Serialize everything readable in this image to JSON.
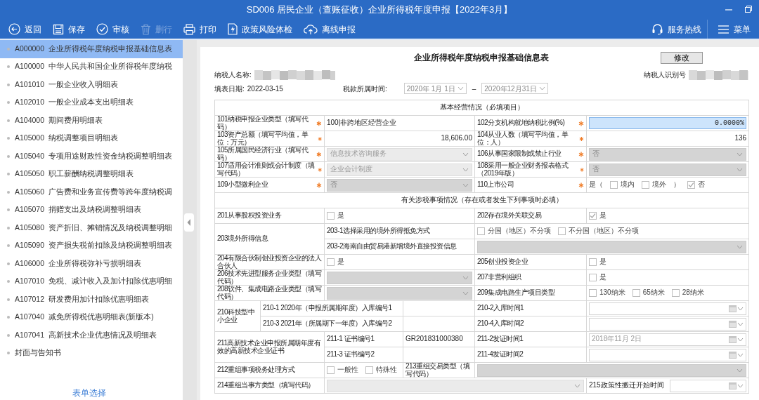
{
  "window": {
    "title": "SD006 居民企业（查账征收）企业所得税年度申报【2022年3月】"
  },
  "toolbar": [
    {
      "label": "返回",
      "disabled": false
    },
    {
      "label": "保存",
      "disabled": false
    },
    {
      "label": "审核",
      "disabled": false
    },
    {
      "label": "删行",
      "disabled": true
    },
    {
      "label": "打印",
      "disabled": false
    },
    {
      "label": "政策风险体检",
      "disabled": false
    },
    {
      "label": "离线申报",
      "disabled": false
    }
  ],
  "toolbar_right": [
    {
      "label": "服务热线"
    },
    {
      "label": "菜单"
    }
  ],
  "sidebar": {
    "items": [
      {
        "code": "A000000",
        "name": "企业所得税年度纳税申报基础信息表",
        "selected": true
      },
      {
        "code": "A100000",
        "name": "中华人民共和国企业所得税年度纳税",
        "selected": false
      },
      {
        "code": "A101010",
        "name": "一般企业收入明细表",
        "selected": false
      },
      {
        "code": "A102010",
        "name": "一般企业成本支出明细表",
        "selected": false
      },
      {
        "code": "A104000",
        "name": "期间费用明细表",
        "selected": false
      },
      {
        "code": "A105000",
        "name": "纳税调整项目明细表",
        "selected": false
      },
      {
        "code": "A105040",
        "name": "专项用途财政性资金纳税调整明细表",
        "selected": false
      },
      {
        "code": "A105050",
        "name": "职工薪酬纳税调整明细表",
        "selected": false
      },
      {
        "code": "A105060",
        "name": "广告费和业务宣传费等跨年度纳税调",
        "selected": false
      },
      {
        "code": "A105070",
        "name": "捐赠支出及纳税调整明细表",
        "selected": false
      },
      {
        "code": "A105080",
        "name": "资产折旧、摊销情况及纳税调整明细",
        "selected": false
      },
      {
        "code": "A105090",
        "name": "资产损失税前扣除及纳税调整明细表",
        "selected": false
      },
      {
        "code": "A106000",
        "name": "企业所得税弥补亏损明细表",
        "selected": false
      },
      {
        "code": "A107010",
        "name": "免税、减计收入及加计扣除优惠明细",
        "selected": false
      },
      {
        "code": "A107012",
        "name": "研发费用加计扣除优惠明细表",
        "selected": false
      },
      {
        "code": "A107040",
        "name": "减免所得税优惠明细表(新版本)",
        "selected": false
      },
      {
        "code": "A107041",
        "name": "高新技术企业优惠情况及明细表",
        "selected": false
      },
      {
        "name": "封面与告知书",
        "selected": false
      }
    ],
    "link": "表单选择"
  },
  "form": {
    "title": "企业所得税年度纳税申报基础信息表",
    "edit_button": "修改",
    "taxpayer_name_label": "纳税人名称:",
    "taxpayer_id_label": "纳税人识别号",
    "fill_date_label": "填表日期:",
    "fill_date": "2022-03-15",
    "period_label": "税款所属时间:",
    "period_from": "2020年 1月 1日",
    "period_separator": "–",
    "period_to": "2020年12月31日",
    "rows": [
      {
        "kind": "heading",
        "text": "基本经营情况（必填项目）"
      },
      {
        "kind": "pair",
        "left": {
          "label": "101纳税申报企业类型（填写代码）",
          "required": true,
          "field": {
            "kind": "text",
            "value": "100|非跨地区经营企业"
          }
        },
        "right": {
          "label": "102分支机构就地纳税比例(%)",
          "required": true,
          "field": {
            "kind": "input",
            "value": "0.0000%"
          }
        }
      },
      {
        "kind": "pair",
        "left": {
          "label": "103资产总额（填写平均值，单位：万元）",
          "required": true,
          "field": {
            "kind": "number",
            "value": "18,606.00"
          }
        },
        "right": {
          "label": "104从业人数（填写平均值，单位：人）",
          "required": true,
          "field": {
            "kind": "number",
            "value": "136"
          }
        }
      },
      {
        "kind": "pair",
        "left": {
          "label": "105所属国民经济行业（填写代码）",
          "required": true,
          "field": {
            "kind": "select",
            "locked": false,
            "value": "信息技术咨询服务"
          }
        },
        "right": {
          "label": "106从事国家限制或禁止行业",
          "required": true,
          "field": {
            "kind": "select",
            "locked": true,
            "value": "否"
          }
        }
      },
      {
        "kind": "pair",
        "left": {
          "label": "107适用会计准则或会计制度（填写代码）",
          "required": true,
          "field": {
            "kind": "select",
            "locked": false,
            "value": "企业会计制度"
          }
        },
        "right": {
          "label": "108采用一般企业财务报表格式（2019年版）",
          "required": true,
          "field": {
            "kind": "select",
            "locked": true,
            "value": "否"
          }
        }
      },
      {
        "kind": "pair",
        "left": {
          "label": "109小型微利企业",
          "required": true,
          "field": {
            "kind": "select",
            "locked": true,
            "value": "否"
          }
        },
        "right": {
          "label": "110上市公司",
          "required": true,
          "field": {
            "kind": "checks",
            "items": [
              {
                "kind": "text",
                "text": "是（"
              },
              {
                "kind": "check",
                "label": "境内",
                "checked": false
              },
              {
                "kind": "check",
                "label": "境外",
                "checked": false
              },
              {
                "kind": "text",
                "text": "）"
              },
              {
                "kind": "check",
                "label": "否",
                "checked": true
              }
            ]
          }
        }
      },
      {
        "kind": "heading",
        "text": "有关涉税事项情况（存在或者发生下列事项时必填）"
      },
      {
        "kind": "pair",
        "left": {
          "label": "201从事股权投资业务",
          "required": false,
          "field": {
            "kind": "checks",
            "items": [
              {
                "kind": "check",
                "label": "是",
                "checked": false
              }
            ]
          }
        },
        "right": {
          "label": "202存在境外关联交易",
          "required": false,
          "field": {
            "kind": "checks",
            "items": [
              {
                "kind": "check",
                "label": "是",
                "checked": true
              }
            ]
          }
        }
      },
      {
        "kind": "group_wide",
        "label": "203境外所得信息",
        "subrows": [
          {
            "label": "203-1选择采用的境外所得抵免方式",
            "field": {
              "kind": "checks",
              "items": [
                {
                  "kind": "check",
                  "label": "分国（地区）不分项",
                  "checked": false
                },
                {
                  "kind": "check",
                  "label": "不分国（地区）不分项",
                  "checked": false
                }
              ]
            }
          },
          {
            "label": "203-2海南自由贸易港新增境外直接投资信息",
            "field": {
              "kind": "select",
              "locked": true
            }
          }
        ]
      },
      {
        "kind": "pair",
        "left": {
          "label": "204有限合伙制创业投资企业的法人合伙人",
          "required": false,
          "field": {
            "kind": "checks",
            "items": [
              {
                "kind": "check",
                "label": "是",
                "checked": false
              }
            ]
          }
        },
        "right": {
          "label": "205创业投资企业",
          "required": false,
          "field": {
            "kind": "checks",
            "items": [
              {
                "kind": "check",
                "label": "是",
                "checked": false
              }
            ]
          }
        }
      },
      {
        "kind": "pair",
        "left": {
          "label": "206技术先进型服务企业类型（填写代码）",
          "required": false,
          "field": {
            "kind": "select",
            "locked": true
          }
        },
        "right": {
          "label": "207非营利组织",
          "required": false,
          "field": {
            "kind": "checks",
            "items": [
              {
                "kind": "check",
                "label": "是",
                "checked": false
              }
            ]
          }
        }
      },
      {
        "kind": "pair",
        "left": {
          "label": "208软件、集成电路企业类型（填写代码）",
          "required": false,
          "field": {
            "kind": "select",
            "locked": true
          }
        },
        "right": {
          "label": "209集成电路生产项目类型",
          "required": false,
          "field": {
            "kind": "checks",
            "items": [
              {
                "kind": "check",
                "label": "130纳米",
                "checked": false
              },
              {
                "kind": "check",
                "label": "65纳米",
                "checked": false
              },
              {
                "kind": "check",
                "label": "28纳米",
                "checked": false
              }
            ]
          }
        }
      },
      {
        "kind": "group_short",
        "label": "210科技型中小企业",
        "subrows": [
          {
            "label": "210-1 2020年（申报所属期年度）入库编号1",
            "label2": "210-2入库时间1",
            "field": {
              "kind": "date"
            }
          },
          {
            "label": "210-3 2021年（所属期下一年度）入库编号2",
            "label2": "210-4入库时间2",
            "field": {
              "kind": "date"
            }
          }
        ]
      },
      {
        "kind": "group_long",
        "label": "211高新技术企业申报所属期年度有效的高新技术企业证书",
        "subrows": [
          {
            "label": "211-1 证书编号1",
            "value": "GR201831000380",
            "label2": "211-2发证时间1",
            "field": {
              "kind": "date",
              "value": "2018年11月 2日"
            }
          },
          {
            "label": "211-3 证书编号2",
            "label2": "211-4发证时间2",
            "field": {
              "kind": "date"
            }
          }
        ]
      },
      {
        "kind": "split",
        "label": "212重组事项税务处理方式",
        "field": {
          "kind": "checks",
          "items": [
            {
              "kind": "check",
              "label": "一般性",
              "checked": false
            },
            {
              "kind": "check",
              "label": "特殊性",
              "checked": false
            }
          ]
        },
        "label2": "213重组交易类型（填写代码）",
        "field2": {
          "kind": "select",
          "locked": true
        }
      },
      {
        "kind": "wide_select",
        "label": "214重组当事方类型（填写代码）",
        "field": {
          "kind": "select",
          "locked": false
        },
        "label2": "215政策性搬迁开始时间",
        "field2": {
          "kind": "date"
        }
      }
    ]
  }
}
